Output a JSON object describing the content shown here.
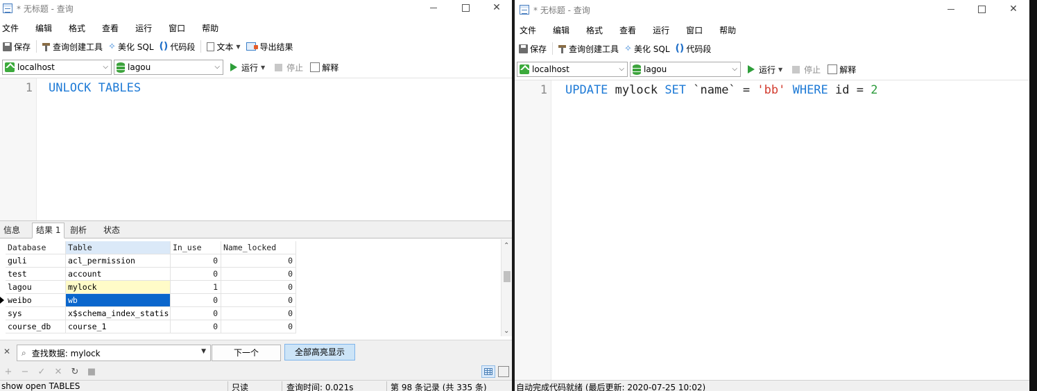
{
  "left": {
    "title": "* 无标题 - 查询",
    "menu": [
      "文件",
      "编辑",
      "格式",
      "查看",
      "运行",
      "窗口",
      "帮助"
    ],
    "toolbar": {
      "save": "保存",
      "query_builder": "查询创建工具",
      "beautify": "美化 SQL",
      "snippet": "代码段",
      "text": "文本",
      "export": "导出结果"
    },
    "connection": "localhost",
    "database": "lagou",
    "run": "运行",
    "stop": "停止",
    "explain": "解释",
    "editor": {
      "line": "1",
      "tokens": [
        {
          "text": "UNLOCK",
          "type": "kw"
        },
        {
          "text": " ",
          "type": "id"
        },
        {
          "text": "TABLES",
          "type": "kw"
        }
      ]
    },
    "tabs": [
      "信息",
      "结果 1",
      "剖析",
      "状态"
    ],
    "active_tab": 1,
    "grid": {
      "columns": [
        "Database",
        "Table",
        "In_use",
        "Name_locked"
      ],
      "rows": [
        [
          "guli",
          "acl_permission",
          "0",
          "0"
        ],
        [
          "test",
          "account",
          "0",
          "0"
        ],
        [
          "lagou",
          "mylock",
          "1",
          "0"
        ],
        [
          "weibo",
          "wb",
          "0",
          "0"
        ],
        [
          "sys",
          "x$schema_index_statis",
          "0",
          "0"
        ],
        [
          "course_db",
          "course_1",
          "0",
          "0"
        ]
      ]
    },
    "find": {
      "value": "查找数据: mylock",
      "next": "下一个",
      "highlight_all": "全部高亮显示"
    },
    "status": {
      "sql": "show open TABLES",
      "mode": "只读",
      "query_time": "查询时间: 0.021s",
      "records": "第 98 条记录 (共 335 条)"
    }
  },
  "right": {
    "title": "* 无标题 - 查询",
    "menu": [
      "文件",
      "编辑",
      "格式",
      "查看",
      "运行",
      "窗口",
      "帮助"
    ],
    "toolbar": {
      "save": "保存",
      "query_builder": "查询创建工具",
      "beautify": "美化 SQL",
      "snippet": "代码段"
    },
    "connection": "localhost",
    "database": "lagou",
    "run": "运行",
    "stop": "停止",
    "explain": "解释",
    "editor": {
      "line": "1",
      "tokens": [
        {
          "text": "UPDATE",
          "type": "kw"
        },
        {
          "text": " mylock ",
          "type": "id"
        },
        {
          "text": "SET",
          "type": "kw"
        },
        {
          "text": " `name` = ",
          "type": "id"
        },
        {
          "text": "'bb'",
          "type": "str"
        },
        {
          "text": " ",
          "type": "id"
        },
        {
          "text": "WHERE",
          "type": "kw"
        },
        {
          "text": " id = ",
          "type": "id"
        },
        {
          "text": "2",
          "type": "num"
        }
      ]
    },
    "status": {
      "text": "自动完成代码就绪 (最后更新: 2020-07-25 10:02)"
    }
  },
  "colors": {
    "keyword": "#1e7ad6",
    "string": "#d23b2e",
    "number": "#2b9a3b",
    "selected_cell": "#0a66cc",
    "highlight_cell": "#fffbc8"
  },
  "icons": [
    "app-icon",
    "save-icon",
    "hammer-icon",
    "wand-icon",
    "braces-icon",
    "text-icon",
    "export-icon",
    "host-icon",
    "database-icon",
    "play-icon",
    "stop-icon",
    "explain-icon",
    "search-icon",
    "refresh-icon"
  ]
}
